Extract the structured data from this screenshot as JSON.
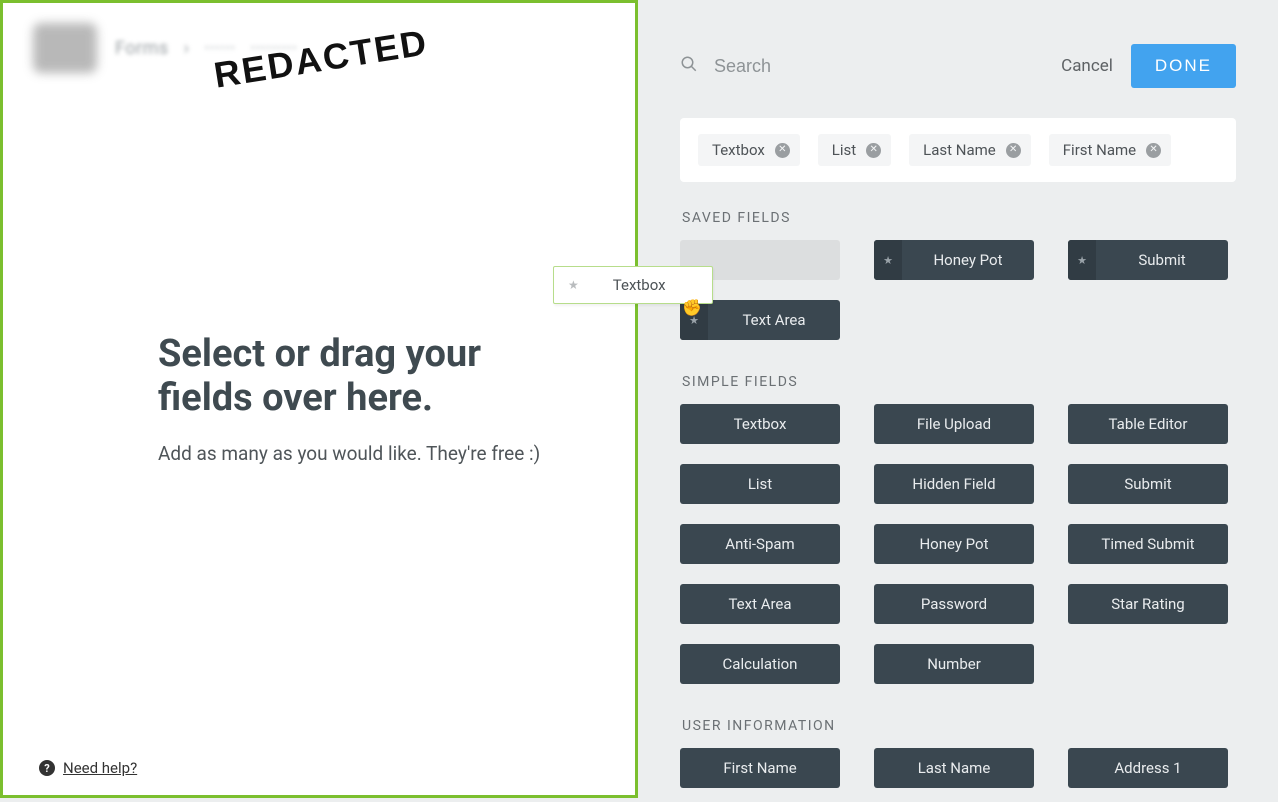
{
  "redacted_stamp": "REDACTED",
  "dropzone": {
    "title_line1": "Select or drag your",
    "title_line2": "fields over here.",
    "subtitle": "Add as many as you would like. They're free :)"
  },
  "help_label": "Need help?",
  "dragging_field_label": "Textbox",
  "search": {
    "placeholder": "Search"
  },
  "actions": {
    "cancel": "Cancel",
    "done": "DONE"
  },
  "selected_tags": [
    "Textbox",
    "List",
    "Last Name",
    "First Name"
  ],
  "sections": {
    "saved": {
      "title": "SAVED FIELDS",
      "items": [
        {
          "label": "",
          "placeholder": true,
          "star": false
        },
        {
          "label": "Honey Pot",
          "star": true
        },
        {
          "label": "Submit",
          "star": true
        },
        {
          "label": "Text Area",
          "star": true
        }
      ]
    },
    "simple": {
      "title": "SIMPLE FIELDS",
      "items": [
        {
          "label": "Textbox"
        },
        {
          "label": "File Upload"
        },
        {
          "label": "Table Editor"
        },
        {
          "label": "List"
        },
        {
          "label": "Hidden Field"
        },
        {
          "label": "Submit"
        },
        {
          "label": "Anti-Spam"
        },
        {
          "label": "Honey Pot"
        },
        {
          "label": "Timed Submit"
        },
        {
          "label": "Text Area"
        },
        {
          "label": "Password"
        },
        {
          "label": "Star Rating"
        },
        {
          "label": "Calculation"
        },
        {
          "label": "Number"
        }
      ]
    },
    "user_info": {
      "title": "USER INFORMATION",
      "items": [
        {
          "label": "First Name"
        },
        {
          "label": "Last Name"
        },
        {
          "label": "Address 1"
        }
      ]
    }
  }
}
